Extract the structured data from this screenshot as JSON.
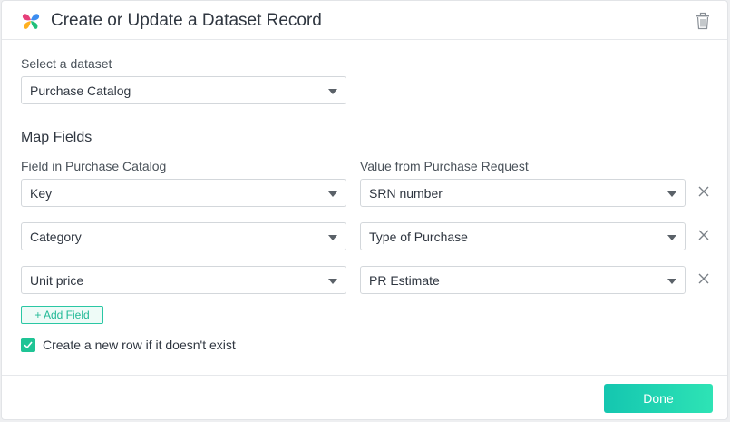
{
  "header": {
    "title": "Create or Update a Dataset Record",
    "logo_icon": "butterfly-logo",
    "delete_icon": "trash-icon"
  },
  "dataset": {
    "label": "Select a dataset",
    "selected": "Purchase Catalog"
  },
  "map_fields": {
    "title": "Map Fields",
    "left_header": "Field in Purchase Catalog",
    "right_header": "Value from Purchase Request",
    "rows": [
      {
        "field": "Key",
        "value": "SRN number"
      },
      {
        "field": "Category",
        "value": "Type of Purchase"
      },
      {
        "field": "Unit price",
        "value": "PR Estimate"
      }
    ],
    "add_label": "+ Add Field"
  },
  "create_row": {
    "checked": true,
    "label": "Create a new row if it doesn't exist"
  },
  "footer": {
    "done_label": "Done"
  },
  "colors": {
    "accent": "#1fc495",
    "done_start": "#14c6b0",
    "done_end": "#2ee3b5"
  }
}
